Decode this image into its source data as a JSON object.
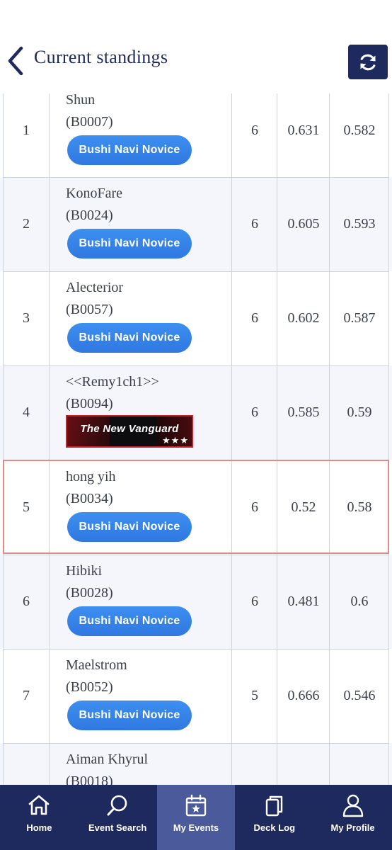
{
  "header": {
    "title": "Current standings",
    "back_icon": "chevron-left-icon",
    "refresh_icon": "refresh-icon"
  },
  "standings": [
    {
      "rank": "1",
      "name": "Shun",
      "code": "(B0007)",
      "badge": "Bushi Navi Novice",
      "points": "6",
      "omw": "0.631",
      "oomw": "0.582"
    },
    {
      "rank": "2",
      "name": "KonoFare",
      "code": "(B0024)",
      "badge": "Bushi Navi Novice",
      "points": "6",
      "omw": "0.605",
      "oomw": "0.593"
    },
    {
      "rank": "3",
      "name": "Alecterior",
      "code": "(B0057)",
      "badge": "Bushi Navi Novice",
      "points": "6",
      "omw": "0.602",
      "oomw": "0.587"
    },
    {
      "rank": "4",
      "name": "<<Remy1ch1>>",
      "code": "(B0094)",
      "badge": "The New Vanguard",
      "badge_stars": "★★★",
      "points": "6",
      "omw": "0.585",
      "oomw": "0.59"
    },
    {
      "rank": "5",
      "name": "hong yih",
      "code": "(B0034)",
      "badge": "Bushi Navi Novice",
      "points": "6",
      "omw": "0.52",
      "oomw": "0.58"
    },
    {
      "rank": "6",
      "name": "Hibiki",
      "code": "(B0028)",
      "badge": "Bushi Navi Novice",
      "points": "6",
      "omw": "0.481",
      "oomw": "0.6"
    },
    {
      "rank": "7",
      "name": "Maelstrom",
      "code": "(B0052)",
      "badge": "Bushi Navi Novice",
      "points": "5",
      "omw": "0.666",
      "oomw": "0.546"
    },
    {
      "rank": "",
      "name": "Aiman Khyrul",
      "code": "(B0018)",
      "badge": "",
      "points": "",
      "omw": "",
      "oomw": ""
    }
  ],
  "highlighted_rank": "5",
  "colors": {
    "navy": "#1e2a5e",
    "badge_blue": "#2f78e0",
    "highlight_border": "#e08a8a",
    "active_tab": "#4a5a9a"
  },
  "bottom_nav": [
    {
      "label": "Home",
      "icon": "home-icon"
    },
    {
      "label": "Event Search",
      "icon": "search-icon"
    },
    {
      "label": "My Events",
      "icon": "calendar-star-icon",
      "active": true
    },
    {
      "label": "Deck Log",
      "icon": "cards-icon"
    },
    {
      "label": "My Profile",
      "icon": "user-icon"
    }
  ]
}
